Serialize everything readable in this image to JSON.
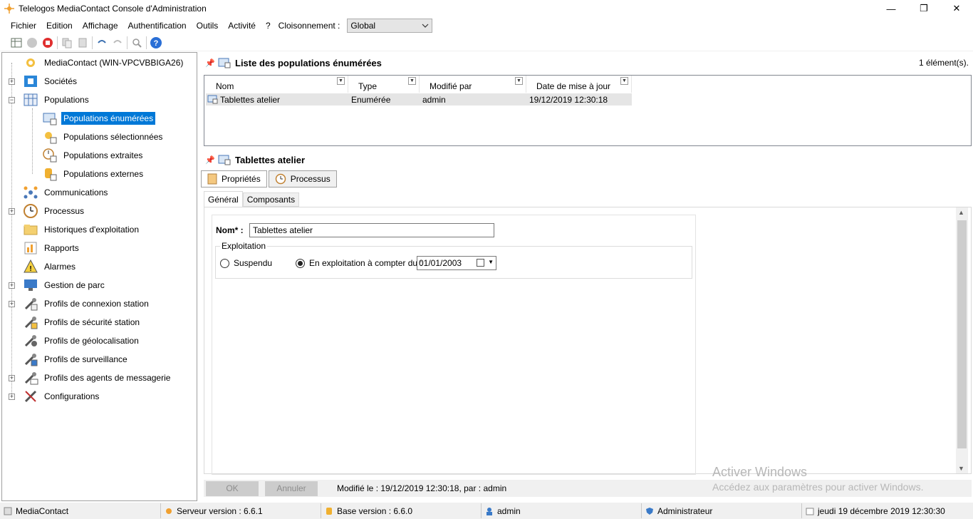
{
  "window": {
    "title": "Telelogos MediaContact Console d'Administration",
    "minimize": "—",
    "restore": "❐",
    "close": "✕"
  },
  "menu": {
    "items": [
      "Fichier",
      "Edition",
      "Affichage",
      "Authentification",
      "Outils",
      "Activité",
      "?"
    ],
    "cloisonnement_label": "Cloisonnement :",
    "cloisonnement_value": "Global"
  },
  "tree": {
    "root": "MediaContact (WIN-VPCVBBIGA26)",
    "items": [
      "Sociétés",
      "Populations",
      "Populations énumérées",
      "Populations sélectionnées",
      "Populations extraites",
      "Populations externes",
      "Communications",
      "Processus",
      "Historiques d'exploitation",
      "Rapports",
      "Alarmes",
      "Gestion de parc",
      "Profils de connexion station",
      "Profils de sécurité station",
      "Profils de géolocalisation",
      "Profils de surveillance",
      "Profils des agents de messagerie",
      "Configurations"
    ]
  },
  "list_panel": {
    "title": "Liste des populations énumérées",
    "count": "1 élément(s).",
    "columns": [
      "Nom",
      "Type",
      "Modifié par",
      "Date de mise à jour"
    ],
    "rows": [
      [
        "Tablettes atelier",
        "Enumérée",
        "admin",
        "19/12/2019 12:30:18"
      ]
    ]
  },
  "detail_panel": {
    "title": "Tablettes atelier",
    "tabs": [
      "Propriétés",
      "Processus"
    ],
    "subtabs": [
      "Général",
      "Composants"
    ],
    "nom_label": "Nom* :",
    "nom_value": "Tablettes atelier",
    "exploitation_label": "Exploitation",
    "radio_suspendu": "Suspendu",
    "radio_exploitation": "En exploitation à compter du :",
    "date_value": "01/01/2003",
    "ok": "OK",
    "annuler": "Annuler",
    "modified": "Modifié le : 19/12/2019 12:30:18, par : admin"
  },
  "watermark": {
    "line1": "Activer Windows",
    "line2": "Accédez aux paramètres pour activer Windows."
  },
  "status": {
    "app": "MediaContact",
    "server": "Serveur version : 6.6.1",
    "base": "Base version : 6.6.0",
    "user": "admin",
    "role": "Administrateur",
    "datetime": "jeudi 19 décembre 2019 12:30:30"
  }
}
